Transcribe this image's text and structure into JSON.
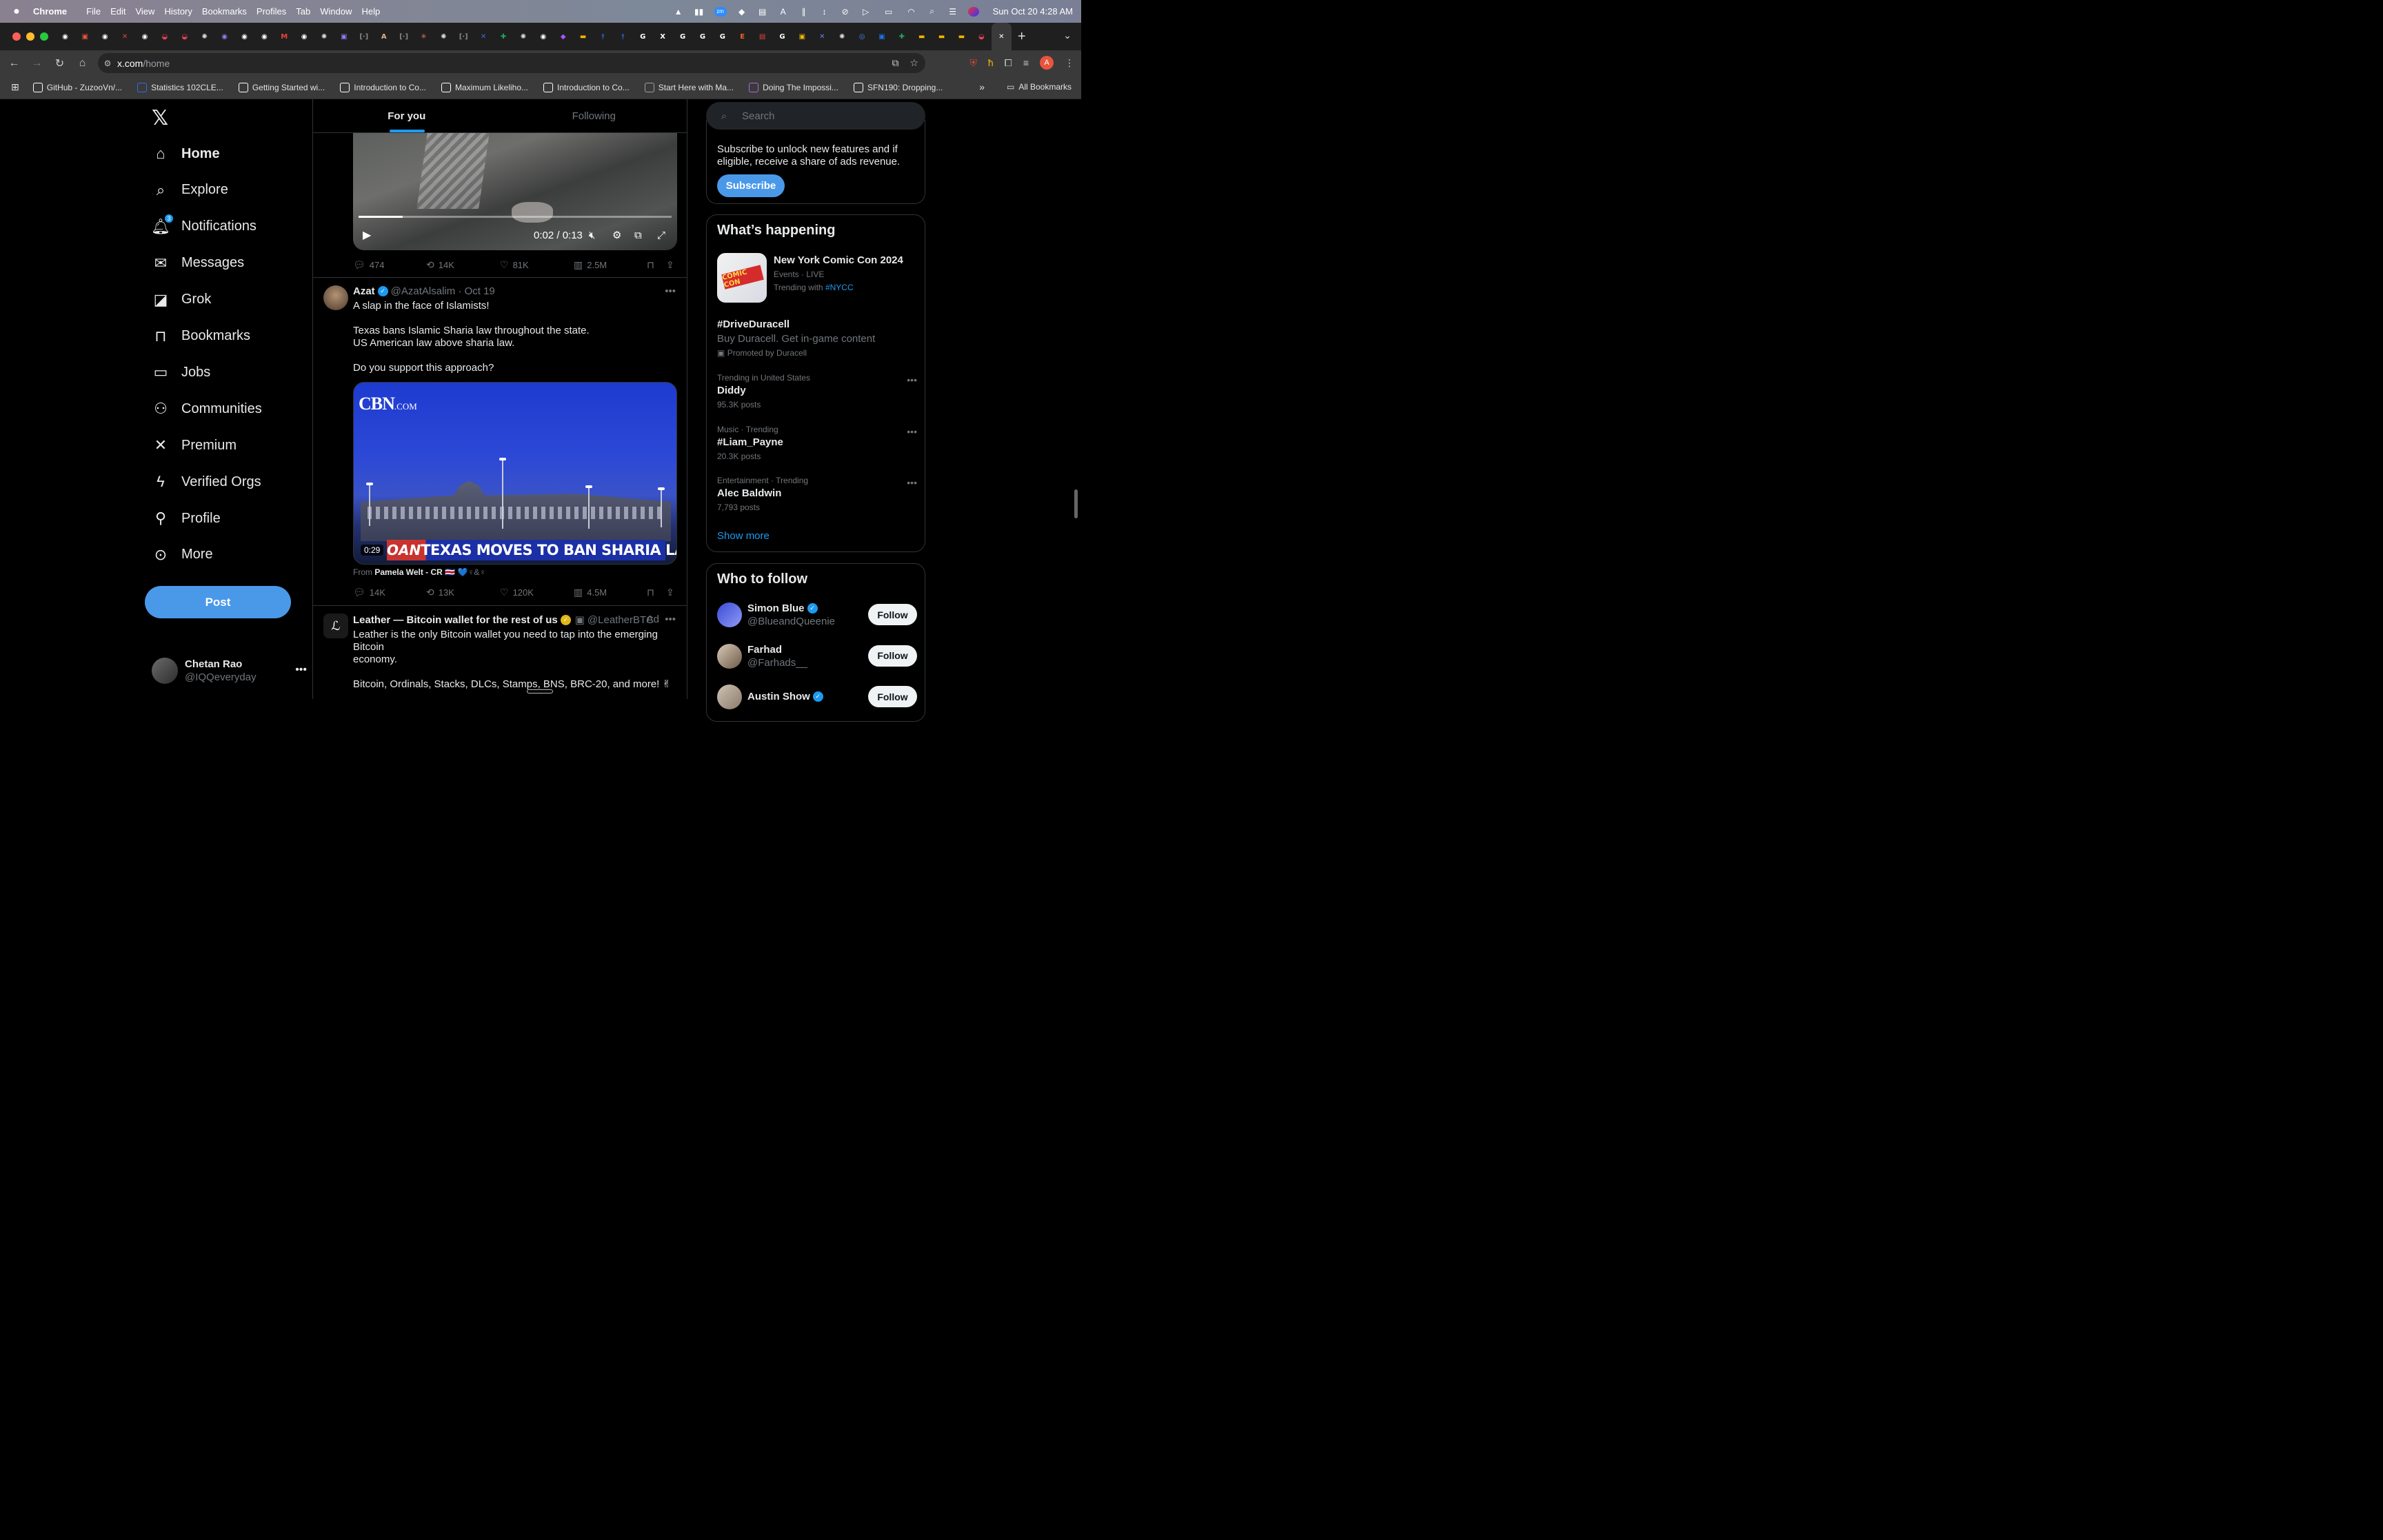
{
  "menubar": {
    "apple": "",
    "app": "Chrome",
    "items": [
      "File",
      "Edit",
      "View",
      "History",
      "Bookmarks",
      "Profiles",
      "Tab",
      "Window",
      "Help"
    ],
    "clock": "Sun Oct 20  4:28 AM"
  },
  "tabs": {
    "favicons": [
      {
        "icon": "github-icon",
        "color": "#ffffff",
        "glyph": "◉"
      },
      {
        "icon": "app-icon",
        "color": "#e8543d",
        "glyph": "▣"
      },
      {
        "icon": "github-icon",
        "color": "#ffffff",
        "glyph": "◉"
      },
      {
        "icon": "x-red-icon",
        "color": "#e0433a",
        "glyph": "✕"
      },
      {
        "icon": "github-icon",
        "color": "#ffffff",
        "glyph": "◉"
      },
      {
        "icon": "pocket-icon",
        "color": "#ef3f56",
        "glyph": "◒"
      },
      {
        "icon": "pocket-icon",
        "color": "#ef3f56",
        "glyph": "◒"
      },
      {
        "icon": "openai-icon",
        "color": "#dddddd",
        "glyph": "✺"
      },
      {
        "icon": "app-icon",
        "color": "#8f7bf2",
        "glyph": "◉"
      },
      {
        "icon": "github-icon",
        "color": "#ffffff",
        "glyph": "◉"
      },
      {
        "icon": "github-icon",
        "color": "#ffffff",
        "glyph": "◉"
      },
      {
        "icon": "gmail-icon",
        "color": "#ea4335",
        "glyph": "M"
      },
      {
        "icon": "github-icon",
        "color": "#ffffff",
        "glyph": "◉"
      },
      {
        "icon": "openai-icon",
        "color": "#dddddd",
        "glyph": "✺"
      },
      {
        "icon": "app-icon",
        "color": "#8f7bf2",
        "glyph": "▣"
      },
      {
        "icon": "bracket-icon",
        "color": "#888888",
        "glyph": "[·]"
      },
      {
        "icon": "anthropic-icon",
        "color": "#d9b38c",
        "glyph": "A"
      },
      {
        "icon": "bracket-icon",
        "color": "#888888",
        "glyph": "[·]"
      },
      {
        "icon": "claude-icon",
        "color": "#d97757",
        "glyph": "✳"
      },
      {
        "icon": "openai-icon",
        "color": "#dddddd",
        "glyph": "✺"
      },
      {
        "icon": "bracket-icon",
        "color": "#888888",
        "glyph": "[·]"
      },
      {
        "icon": "app-icon",
        "color": "#2f6fe0",
        "glyph": "✕"
      },
      {
        "icon": "sheets-icon",
        "color": "#22a565",
        "glyph": "✚"
      },
      {
        "icon": "openai-icon",
        "color": "#dddddd",
        "glyph": "✺"
      },
      {
        "icon": "github-icon",
        "color": "#ffffff",
        "glyph": "◉"
      },
      {
        "icon": "figma-icon",
        "color": "#a259ff",
        "glyph": "◆"
      },
      {
        "icon": "slides-icon",
        "color": "#f4b400",
        "glyph": "▬"
      },
      {
        "icon": "app-icon",
        "color": "#2f6fe0",
        "glyph": "⫯"
      },
      {
        "icon": "app-icon",
        "color": "#2f6fe0",
        "glyph": "⫯"
      },
      {
        "icon": "google-icon",
        "color": "#ffffff",
        "glyph": "G"
      },
      {
        "icon": "x-icon",
        "color": "#ffffff",
        "glyph": "X"
      },
      {
        "icon": "google-icon",
        "color": "#ffffff",
        "glyph": "G"
      },
      {
        "icon": "google-icon",
        "color": "#ffffff",
        "glyph": "G"
      },
      {
        "icon": "google-icon",
        "color": "#ffffff",
        "glyph": "G"
      },
      {
        "icon": "etsy-icon",
        "color": "#f1641e",
        "glyph": "E"
      },
      {
        "icon": "app-icon",
        "color": "#e0433a",
        "glyph": "▤"
      },
      {
        "icon": "google-icon",
        "color": "#ffffff",
        "glyph": "G"
      },
      {
        "icon": "app-icon",
        "color": "#f4b400",
        "glyph": "▣"
      },
      {
        "icon": "app-icon",
        "color": "#6a7cf0",
        "glyph": "✕"
      },
      {
        "icon": "openai-icon",
        "color": "#dddddd",
        "glyph": "✺"
      },
      {
        "icon": "chrome-icon",
        "color": "#4285f4",
        "glyph": "◎"
      },
      {
        "icon": "app-icon",
        "color": "#1a73e8",
        "glyph": "▣"
      },
      {
        "icon": "sheets-icon",
        "color": "#22a565",
        "glyph": "✚"
      },
      {
        "icon": "slides-icon",
        "color": "#f4b400",
        "glyph": "▬"
      },
      {
        "icon": "slides-icon",
        "color": "#f4b400",
        "glyph": "▬"
      },
      {
        "icon": "slides-icon",
        "color": "#f4b400",
        "glyph": "▬"
      },
      {
        "icon": "pocket-icon",
        "color": "#ef3f56",
        "glyph": "◒"
      },
      {
        "icon": "close-icon",
        "color": "#ffffff",
        "glyph": "✕",
        "active": true
      }
    ],
    "new_tab": "+"
  },
  "omnibox": {
    "host": "x.com",
    "path": "/home"
  },
  "bookmarks": [
    {
      "label": "GitHub - ZuzooVn/...",
      "icon": "github-icon",
      "color": "#ffffff"
    },
    {
      "label": "Statistics 102CLE...",
      "icon": "ucla-icon",
      "color": "#2f6fe0"
    },
    {
      "label": "Getting Started wi...",
      "icon": "app-icon",
      "color": "#ffffff"
    },
    {
      "label": "Introduction to Co...",
      "icon": "bars-icon",
      "color": "#ffffff"
    },
    {
      "label": "Maximum Likeliho...",
      "icon": "chart-icon",
      "color": "#ffffff"
    },
    {
      "label": "Introduction to Co...",
      "icon": "bars-icon",
      "color": "#ffffff"
    },
    {
      "label": "Start Here with Ma...",
      "icon": "app-icon",
      "color": "#9aa0a6"
    },
    {
      "label": "Doing The Impossi...",
      "icon": "app-icon",
      "color": "#b06ad9"
    },
    {
      "label": "SFN190: Dropping...",
      "icon": "f-icon",
      "color": "#ffffff"
    }
  ],
  "all_bookmarks": "All Bookmarks",
  "nav": {
    "items": [
      {
        "label": "Home",
        "icon": "home-icon",
        "bold": true
      },
      {
        "label": "Explore",
        "icon": "search-icon"
      },
      {
        "label": "Notifications",
        "icon": "bell-icon",
        "badge": "3"
      },
      {
        "label": "Messages",
        "icon": "mail-icon"
      },
      {
        "label": "Grok",
        "icon": "grok-icon"
      },
      {
        "label": "Bookmarks",
        "icon": "bookmark-icon"
      },
      {
        "label": "Jobs",
        "icon": "briefcase-icon"
      },
      {
        "label": "Communities",
        "icon": "people-icon"
      },
      {
        "label": "Premium",
        "icon": "x-icon"
      },
      {
        "label": "Verified Orgs",
        "icon": "lightning-icon"
      },
      {
        "label": "Profile",
        "icon": "person-icon"
      },
      {
        "label": "More",
        "icon": "more-circle-icon"
      }
    ],
    "post": "Post",
    "user": {
      "name": "Chetan Rao",
      "handle": "@IQQeveryday"
    }
  },
  "feed": {
    "tabs": [
      "For you",
      "Following"
    ],
    "video1": {
      "time": "0:02 / 0:13",
      "progress": 0.14
    },
    "tweet0_stats": {
      "replies": "474",
      "reposts": "14K",
      "likes": "81K",
      "views": "2.5M"
    },
    "tweet1": {
      "name": "Azat",
      "handle": "@AzatAlsalim · Oct 19",
      "text": "A slap in the face of Islamists!\n\nTexas bans Islamic Sharia law throughout the state.\nUS American law above sharia law.\n\nDo you support this approach?",
      "media": {
        "cbn": "CBN",
        "cbn_suffix": ".COM",
        "oan": "OAN",
        "headline": "TEXAS MOVES TO BAN SHARIA LAW",
        "duration": "0:29"
      },
      "from_prefix": "From",
      "from_name": "Pamela Welt - CR",
      "from_emoji": "🇨🇷 💙♀&♀",
      "stats": {
        "replies": "14K",
        "reposts": "13K",
        "likes": "120K",
        "views": "4.5M"
      }
    },
    "tweet2": {
      "name": "Leather — Bitcoin wallet for the rest of us",
      "handle": "@LeatherBTC",
      "ad": "Ad",
      "text": "Leather is the only Bitcoin wallet you need to tap into the emerging Bitcoin\neconomy.\n\nBitcoin, Ordinals, Stacks, DLCs, Stamps, BNS, BRC-20, and more! ✌\n\nInstall for free ⤵"
    }
  },
  "sidebar": {
    "search_placeholder": "Search",
    "premium": {
      "text": "Subscribe to unlock new features and if eligible, receive a share of ads revenue.",
      "button": "Subscribe"
    },
    "happening": {
      "title": "What’s happening",
      "featured": {
        "title": "New York Comic Con 2024",
        "context": "Events · LIVE",
        "trending_prefix": "Trending with",
        "trending_tag": "#NYCC",
        "img_text": "COMIC CON"
      },
      "promoted": {
        "title": "#DriveDuracell",
        "desc": "Buy Duracell. Get in-game content",
        "promo": "Promoted by Duracell"
      },
      "trends": [
        {
          "context": "Trending in United States",
          "title": "Diddy",
          "posts": "95.3K posts"
        },
        {
          "context": "Music · Trending",
          "title": "#Liam_Payne",
          "posts": "20.3K posts"
        },
        {
          "context": "Entertainment · Trending",
          "title": "Alec Baldwin",
          "posts": "7,793 posts"
        }
      ],
      "show_more": "Show more"
    },
    "who_to_follow": {
      "title": "Who to follow",
      "people": [
        {
          "name": "Simon Blue",
          "handle": "@BlueandQueenie",
          "verified": true,
          "button": "Follow"
        },
        {
          "name": "Farhad",
          "handle": "@Farhads__",
          "verified": false,
          "button": "Follow"
        },
        {
          "name": "Austin Show",
          "handle": "",
          "verified": true,
          "button": "Follow"
        }
      ]
    }
  }
}
